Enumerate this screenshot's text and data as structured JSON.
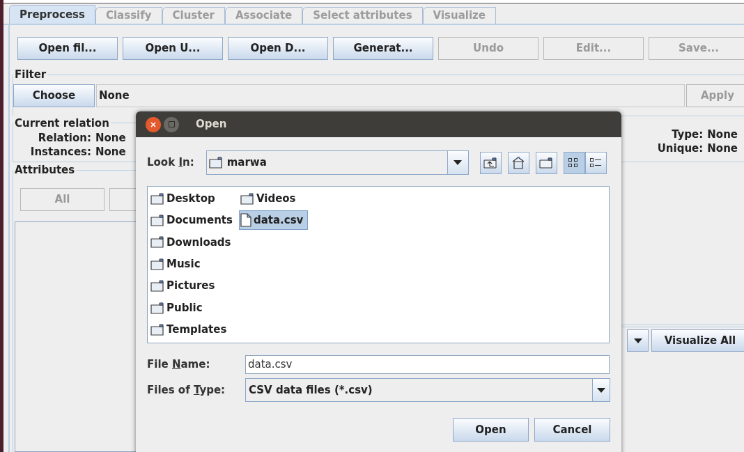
{
  "tabs": [
    {
      "label": "Preprocess",
      "selected": true
    },
    {
      "label": "Classify",
      "selected": false
    },
    {
      "label": "Cluster",
      "selected": false
    },
    {
      "label": "Associate",
      "selected": false
    },
    {
      "label": "Select attributes",
      "selected": false
    },
    {
      "label": "Visualize",
      "selected": false
    }
  ],
  "toolbar_buttons": [
    {
      "label": "Open fil...",
      "disabled": false
    },
    {
      "label": "Open U...",
      "disabled": false
    },
    {
      "label": "Open D...",
      "disabled": false
    },
    {
      "label": "Generat...",
      "disabled": false
    },
    {
      "label": "Undo",
      "disabled": true
    },
    {
      "label": "Edit...",
      "disabled": true
    },
    {
      "label": "Save...",
      "disabled": true
    }
  ],
  "filter": {
    "title": "Filter",
    "button": "Choose",
    "value": "None",
    "apply": {
      "label": "Apply",
      "disabled": true
    }
  },
  "current_relation": {
    "title": "Current relation",
    "fields": [
      {
        "label": "Relation:",
        "value": "None"
      },
      {
        "label": "Instances:",
        "value": "None"
      }
    ]
  },
  "selected_attribute": {
    "fields": [
      {
        "label": "Type:",
        "value": "None"
      },
      {
        "label": "Unique:",
        "value": "None"
      }
    ]
  },
  "attributes": {
    "title": "Attributes",
    "buttons": [
      {
        "label": "All",
        "disabled": true
      },
      {
        "disabled": true
      }
    ]
  },
  "visualize_all": {
    "label": "Visualize All"
  },
  "dialog": {
    "title": "Open",
    "look_in": {
      "label_parts": [
        "Look ",
        "I",
        "n:"
      ],
      "value": "marwa"
    },
    "view_modes": [
      {
        "kind": "list",
        "selected": true
      },
      {
        "kind": "details",
        "selected": false
      }
    ],
    "files": [
      {
        "name": "Desktop",
        "kind": "folder",
        "selected": false
      },
      {
        "name": "Documents",
        "kind": "folder",
        "selected": false
      },
      {
        "name": "Downloads",
        "kind": "folder",
        "selected": false
      },
      {
        "name": "Music",
        "kind": "folder",
        "selected": false
      },
      {
        "name": "Pictures",
        "kind": "folder",
        "selected": false
      },
      {
        "name": "Public",
        "kind": "folder",
        "selected": false
      },
      {
        "name": "Templates",
        "kind": "folder",
        "selected": false
      },
      {
        "name": "Videos",
        "kind": "folder",
        "selected": false
      },
      {
        "name": "data.csv",
        "kind": "file",
        "selected": true
      }
    ],
    "file_name": {
      "label_parts": [
        "File ",
        "N",
        "ame:"
      ],
      "value": "data.csv"
    },
    "files_of_type": {
      "label_parts": [
        "Files of ",
        "T",
        "ype:"
      ],
      "value": "CSV data files (*.csv)"
    },
    "buttons": [
      "Open",
      "Cancel"
    ]
  }
}
